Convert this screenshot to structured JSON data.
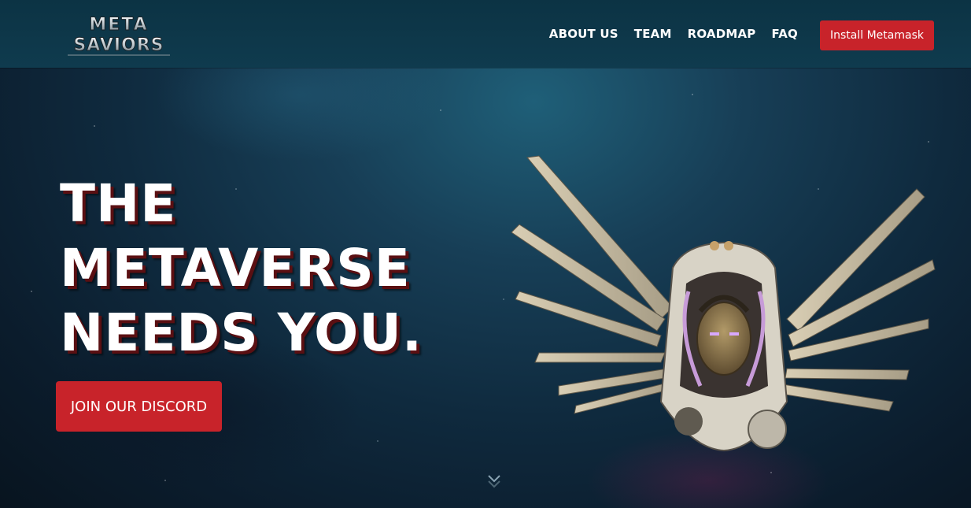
{
  "header": {
    "logo_line1": "META",
    "logo_line2": "SAVIORS",
    "nav": [
      {
        "label": "ABOUT US"
      },
      {
        "label": "TEAM"
      },
      {
        "label": "ROADMAP"
      },
      {
        "label": "FAQ"
      }
    ],
    "install_label": "Install Metamask"
  },
  "hero": {
    "title_lines": [
      "THE",
      "METAVERSE",
      "NEEDS YOU."
    ],
    "discord_label": "JOIN OUR DISCORD",
    "scroll_icon": "chevron-down-icon"
  },
  "colors": {
    "accent": "#c8232a",
    "header_bg": "#0f3b4e",
    "title_shadow": "#5a0f12"
  }
}
